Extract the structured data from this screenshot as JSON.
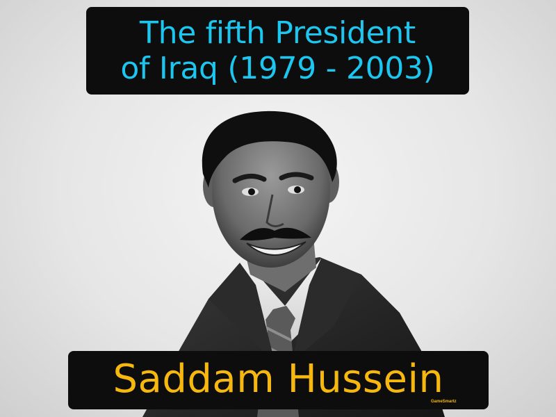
{
  "definition": {
    "line1": "The fifth President",
    "line2": "of Iraq (1979 - 2003)"
  },
  "term": "Saddam Hussein",
  "brand": "GameSmartz",
  "colors": {
    "definition_text": "#1cc6ef",
    "term_text": "#f6b80f",
    "box_background": "#0d0d0d",
    "page_background": "#e6e6e6"
  },
  "image": {
    "subject": "black-and-white portrait photograph"
  }
}
